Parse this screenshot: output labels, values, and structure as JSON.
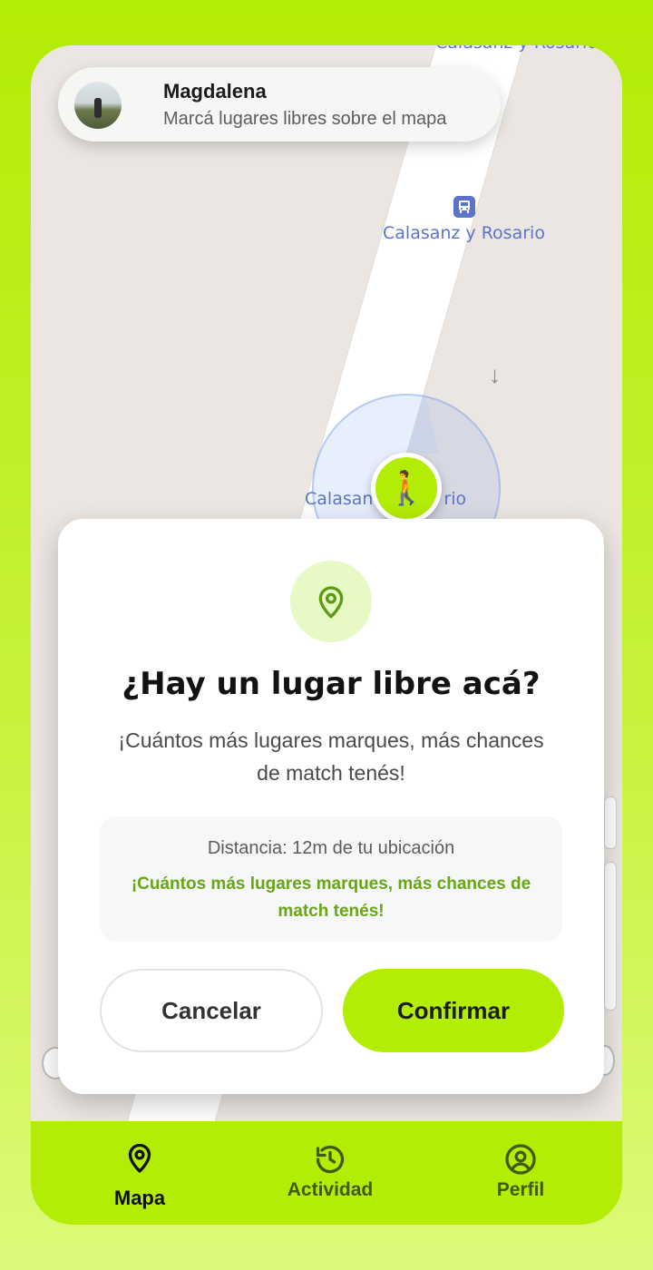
{
  "colors": {
    "accent": "#b3ec04",
    "hint_text": "#69a611",
    "map_label": "#5b74c9"
  },
  "map": {
    "street_label_top": "Calasanz y Rosario",
    "bus_stop_label": "Calasanz y Rosario",
    "street_label_mid_left": "Calasan",
    "street_label_mid_right": "rio",
    "arrow_glyph": "↓",
    "marker_emoji": "🚶"
  },
  "user_card": {
    "name": "Magdalena",
    "subtitle": "Marcá lugares libres sobre el mapa"
  },
  "dialog": {
    "icon": "location-pin-icon",
    "title": "¿Hay un lugar libre acá?",
    "body": "¡Cuántos más lugares marques, más chances de match tenés!",
    "distance": "Distancia: 12m de tu ubicación",
    "hint": "¡Cuántos más lugares marques, más chances de match tenés!",
    "cancel_label": "Cancelar",
    "confirm_label": "Confirmar"
  },
  "tabs": [
    {
      "label": "Mapa",
      "icon": "location-pin-icon",
      "active": true
    },
    {
      "label": "Actividad",
      "icon": "history-icon",
      "active": false
    },
    {
      "label": "Perfil",
      "icon": "user-circle-icon",
      "active": false
    }
  ]
}
